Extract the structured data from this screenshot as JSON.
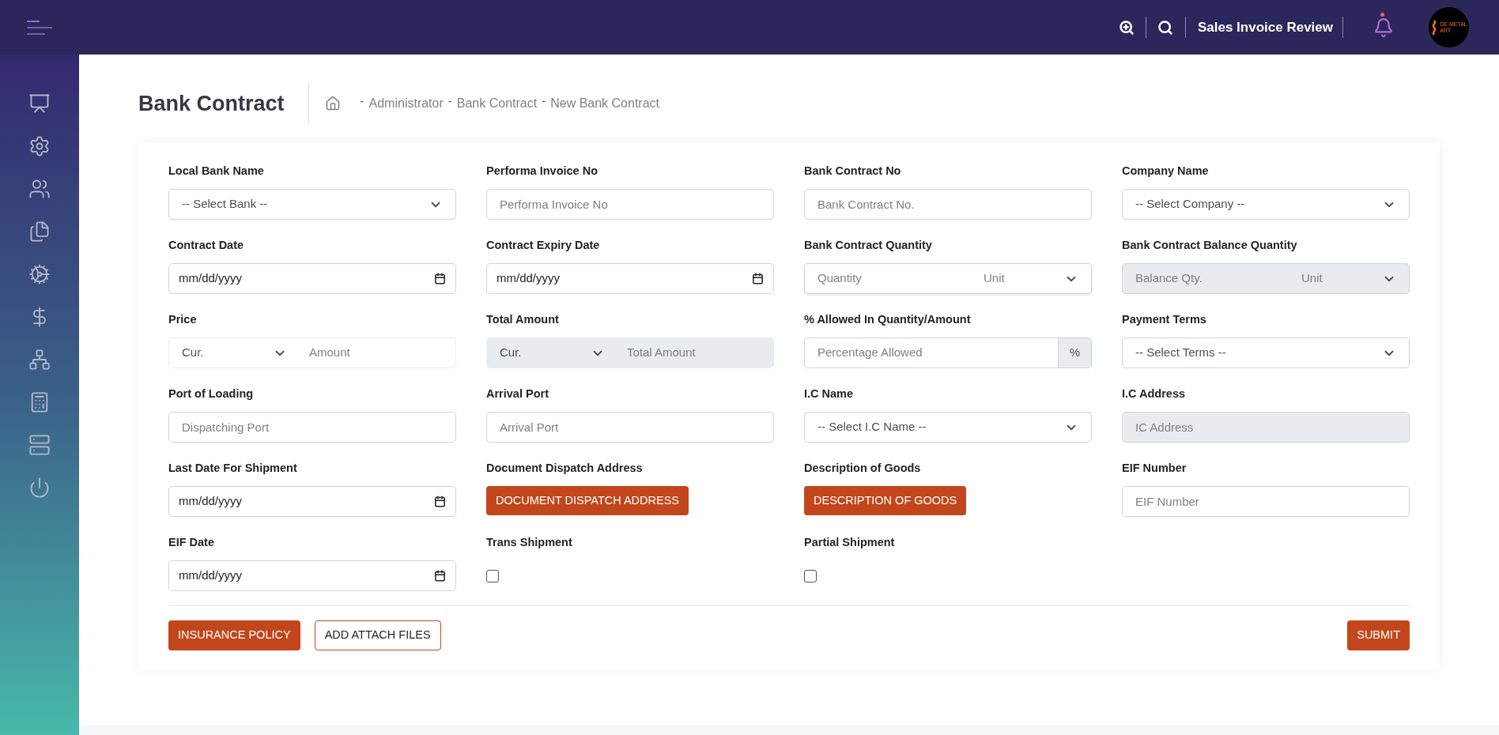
{
  "topbar": {
    "title": "Sales Invoice Review",
    "logo_lines": [
      "DE METAL",
      "ART"
    ]
  },
  "page": {
    "title": "Bank Contract",
    "breadcrumb": [
      {
        "separator": "-",
        "label": "Administrator"
      },
      {
        "separator": "-",
        "label": "Bank Contract"
      },
      {
        "separator": "-",
        "label": "New Bank Contract"
      }
    ]
  },
  "fields": [
    {
      "label": "Local Bank Name",
      "kind": "select",
      "text": "-- Select Bank --",
      "disabled": false
    },
    {
      "label": "Performa Invoice No",
      "kind": "text",
      "placeholder": "Performa Invoice No",
      "disabled": false
    },
    {
      "label": "Bank Contract No",
      "kind": "text",
      "placeholder": "Bank Contract No.",
      "disabled": false
    },
    {
      "label": "Company Name",
      "kind": "select",
      "text": "-- Select Company --",
      "disabled": false
    },
    {
      "label": "Contract Date",
      "kind": "date",
      "text": "mm/dd/yyyy",
      "disabled": false
    },
    {
      "label": "Contract Expiry Date",
      "kind": "date",
      "text": "mm/dd/yyyy",
      "disabled": false
    },
    {
      "label": "Bank Contract Quantity",
      "kind": "quantity",
      "placeholder": "Quantity",
      "unit": "Unit",
      "disabled": false
    },
    {
      "label": "Bank Contract Balance Quantity",
      "kind": "quantity",
      "placeholder": "Balance Qty.",
      "unit": "Unit",
      "disabled": true
    },
    {
      "label": "Price",
      "kind": "currency",
      "currency": "Cur.",
      "placeholder": "Amount",
      "disabled": false
    },
    {
      "label": "Total Amount",
      "kind": "currency",
      "currency": "Cur.",
      "placeholder": "Total Amount",
      "disabled": true
    },
    {
      "label": "% Allowed In Quantity/Amount",
      "kind": "percent",
      "placeholder": "Percentage Allowed",
      "addon": "%",
      "disabled": false
    },
    {
      "label": "Payment Terms",
      "kind": "select",
      "text": "-- Select Terms --",
      "disabled": false
    },
    {
      "label": "Port of Loading",
      "kind": "text",
      "placeholder": "Dispatching Port",
      "disabled": false
    },
    {
      "label": "Arrival Port",
      "kind": "text",
      "placeholder": "Arrival Port",
      "disabled": false
    },
    {
      "label": "I.C Name",
      "kind": "select",
      "text": "-- Select I.C Name --",
      "disabled": false
    },
    {
      "label": "I.C Address",
      "kind": "text",
      "placeholder": "IC Address",
      "disabled": true
    },
    {
      "label": "Last Date For Shipment",
      "kind": "date",
      "text": "mm/dd/yyyy",
      "disabled": false
    },
    {
      "label": "Document Dispatch Address",
      "kind": "button",
      "text": "DOCUMENT DISPATCH ADDRESS"
    },
    {
      "label": "Description of Goods",
      "kind": "button",
      "text": "DESCRIPTION OF GOODS"
    },
    {
      "label": "EIF Number",
      "kind": "text",
      "placeholder": "EIF Number",
      "disabled": false
    },
    {
      "label": "EIF Date",
      "kind": "date",
      "text": "mm/dd/yyyy",
      "disabled": false
    },
    {
      "label": "Trans Shipment",
      "kind": "checkbox",
      "checked": false
    },
    {
      "label": "Partial Shipment",
      "kind": "checkbox",
      "checked": false
    }
  ],
  "actions_left": [
    {
      "label": "INSURANCE POLICY",
      "kind": "filled"
    },
    {
      "label": "ADD ATTACH FILES",
      "kind": "outline"
    }
  ],
  "actions_right": [
    {
      "label": "SUBMIT",
      "kind": "filled"
    }
  ]
}
